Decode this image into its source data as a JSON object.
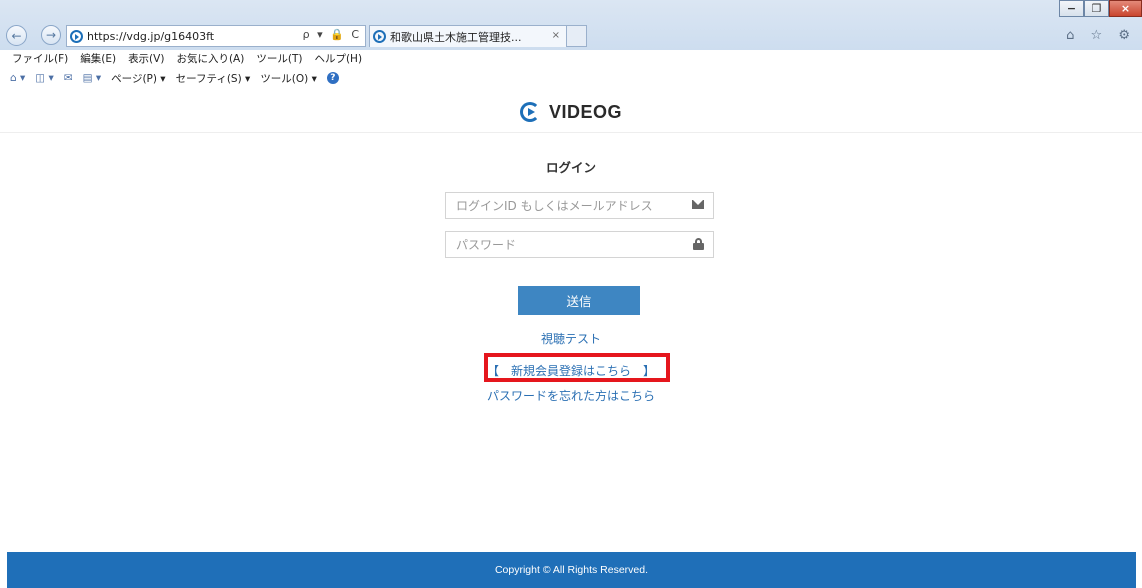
{
  "browser": {
    "url": "https://vdg.jp/g16403ft",
    "tab_title": "和歌山県土木施工管理技...",
    "tab_close": "×",
    "nav_back": "←",
    "nav_forward": "→",
    "address_tools": "ρ ▾ 🔒 C",
    "window_controls": {
      "minimize": "−",
      "restore": "❐",
      "close": "×"
    },
    "right_glyphs": "⌂ ☆ ⚙",
    "menu": [
      "ファイル(F)",
      "編集(E)",
      "表示(V)",
      "お気に入り(A)",
      "ツール(T)",
      "ヘルプ(H)"
    ],
    "commands": {
      "home": "⌂ ▾",
      "feeds": "◫ ▾",
      "mail": "✉",
      "print": "▤ ▾",
      "page": "ページ(P) ▾",
      "safety": "セーフティ(S) ▾",
      "tools": "ツール(O) ▾",
      "help": "?"
    }
  },
  "site": {
    "logo_text": "VIDEOG",
    "brand_color": "#1d6fb8"
  },
  "login": {
    "title": "ログイン",
    "id_placeholder": "ログインID もしくはメールアドレス",
    "password_placeholder": "パスワード",
    "submit_label": "送信",
    "link_test": "視聴テスト",
    "link_register": "【　新規会員登録はこちら　】",
    "link_forgot": "パスワードを忘れた方はこちら"
  },
  "footer": {
    "copyright": "Copyright © All Rights Reserved."
  },
  "annotation": {
    "highlight_color": "#e5161d"
  }
}
